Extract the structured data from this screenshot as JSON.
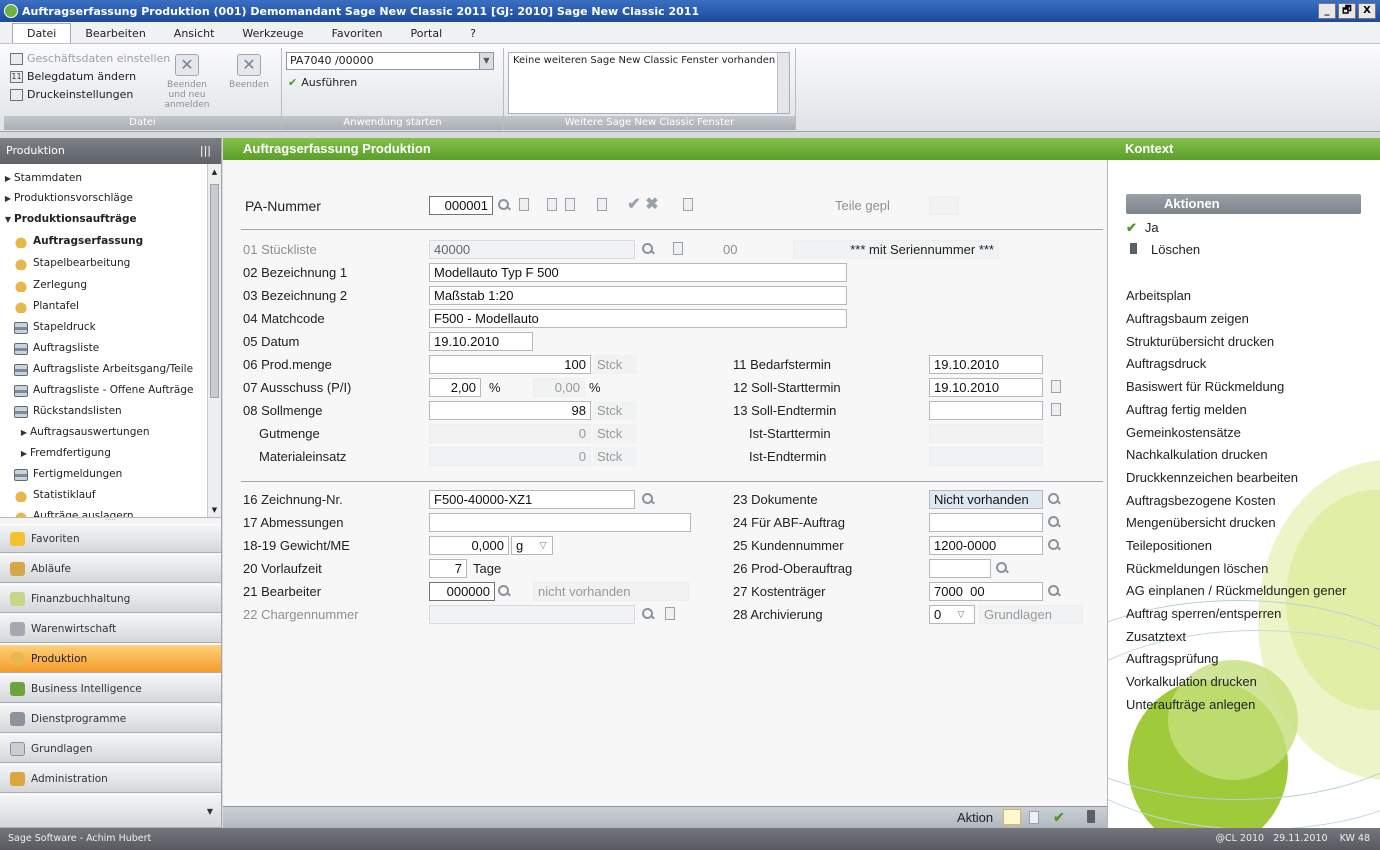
{
  "window": {
    "title": "Auftragserfassung Produktion (001) Demomandant Sage New Classic 2011 [GJ: 2010] Sage New Classic 2011",
    "buttons": [
      "_",
      "🗗",
      "X"
    ]
  },
  "menu": [
    "Datei",
    "Bearbeiten",
    "Ansicht",
    "Werkzeuge",
    "Favoriten",
    "Portal",
    "?"
  ],
  "ribbon": {
    "datei": {
      "caption": "Datei",
      "items": [
        "Geschäftsdaten einstellen",
        "Belegdatum ändern",
        "Druckeinstellungen"
      ],
      "btn1": "Beenden und neu anmelden",
      "btn2": "Beenden"
    },
    "anwendung": {
      "caption": "Anwendung starten",
      "combo": "PA7040 /00000",
      "run": "Ausführen"
    },
    "fenster": {
      "caption": "Weitere Sage New Classic Fenster",
      "text": "Keine weiteren Sage New Classic Fenster vorhanden"
    }
  },
  "nav": {
    "title": "Produktion",
    "tree": [
      {
        "label": "Stammdaten",
        "arrow": "▶"
      },
      {
        "label": "Produktionsvorschläge",
        "arrow": "▶"
      },
      {
        "label": "Produktionsaufträge",
        "arrow": "▼"
      },
      {
        "label": "Auftragserfassung"
      },
      {
        "label": "Stapelbearbeitung"
      },
      {
        "label": "Zerlegung"
      },
      {
        "label": "Plantafel"
      },
      {
        "label": "Stapeldruck"
      },
      {
        "label": "Auftragsliste"
      },
      {
        "label": "Auftragsliste Arbeitsgang/Teile"
      },
      {
        "label": "Auftragsliste - Offene Aufträge"
      },
      {
        "label": "Rückstandslisten"
      },
      {
        "label": "Auftragsauswertungen",
        "arrow": "▶"
      },
      {
        "label": "Fremdfertigung",
        "arrow": "▶"
      },
      {
        "label": "Fertigmeldungen"
      },
      {
        "label": "Statistiklauf"
      },
      {
        "label": "Aufträge auslagern"
      }
    ],
    "modules": [
      "Favoriten",
      "Abläufe",
      "Finanzbuchhaltung",
      "Warenwirtschaft",
      "Produktion",
      "Business Intelligence",
      "Dienstprogramme",
      "Grundlagen",
      "Administration"
    ],
    "gripper": "·····"
  },
  "main": {
    "title": "Auftragserfassung Produktion",
    "pa_label": "PA-Nummer",
    "pa_value": "000001",
    "teile": "Teile gepl",
    "f01": {
      "label": "01 Stückliste",
      "value": "40000",
      "num": "00",
      "note": "*** mit Seriennummer ***"
    },
    "f02": {
      "label": "02 Bezeichnung 1",
      "value": "Modellauto Typ F 500"
    },
    "f03": {
      "label": "03 Bezeichnung 2",
      "value": "Maßstab 1:20"
    },
    "f04": {
      "label": "04 Matchcode",
      "value": "F500 - Modellauto"
    },
    "f05": {
      "label": "05 Datum",
      "value": "19.10.2010"
    },
    "f06": {
      "label": "06 Prod.menge",
      "value": "100",
      "unit": "Stck"
    },
    "f07": {
      "label": "07 Ausschuss (P/I)",
      "value": "2,00",
      "pct": "%",
      "value2": "0,00",
      "pct2": "%"
    },
    "f08": {
      "label": "08 Sollmenge",
      "value": "98",
      "unit": "Stck"
    },
    "gut": {
      "label": "Gutmenge",
      "value": "0",
      "unit": "Stck"
    },
    "mat": {
      "label": "Materialeinsatz",
      "value": "0",
      "unit": "Stck"
    },
    "f11": {
      "label": "11 Bedarfstermin",
      "value": "19.10.2010"
    },
    "f12": {
      "label": "12 Soll-Starttermin",
      "value": "19.10.2010"
    },
    "f13": {
      "label": "13 Soll-Endtermin",
      "value": ""
    },
    "iststart": {
      "label": "Ist-Starttermin"
    },
    "istend": {
      "label": "Ist-Endtermin"
    },
    "f16": {
      "label": "16 Zeichnung-Nr.",
      "value": "F500-40000-XZ1"
    },
    "f17": {
      "label": "17 Abmessungen",
      "value": ""
    },
    "f1819": {
      "label": "18-19 Gewicht/ME",
      "value": "0,000",
      "unit": "g"
    },
    "f20": {
      "label": "20 Vorlaufzeit",
      "value": "7",
      "unit": "Tage"
    },
    "f21": {
      "label": "21 Bearbeiter",
      "value": "000000",
      "note": "nicht vorhanden"
    },
    "f22": {
      "label": "22 Chargennummer",
      "value": ""
    },
    "f23": {
      "label": "23 Dokumente",
      "value": "Nicht vorhanden"
    },
    "f24": {
      "label": "24 Für ABF-Auftrag",
      "value": ""
    },
    "f25": {
      "label": "25 Kundennummer",
      "value": "1200-0000"
    },
    "f26": {
      "label": "26 Prod-Oberauftrag",
      "value": ""
    },
    "f27": {
      "label": "27 Kostenträger",
      "value": "7000  00"
    },
    "f28": {
      "label": "28 Archivierung",
      "value": "0",
      "note": "Grundlagen"
    }
  },
  "actionbar": {
    "label": "Aktion"
  },
  "context": {
    "title": "Kontext",
    "aktionen": "Aktionen",
    "ja": "Ja",
    "loeschen": "Löschen",
    "items": [
      "Arbeitsplan",
      "Auftragsbaum zeigen",
      "Strukturübersicht drucken",
      "Auftragsdruck",
      "Basiswert für Rückmeldung",
      "Auftrag fertig melden",
      "Gemeinkostensätze",
      "Nachkalkulation drucken",
      "Druckkennzeichen bearbeiten",
      "Auftragsbezogene Kosten",
      "Mengenübersicht drucken",
      "Teilepositionen",
      "Rückmeldungen löschen",
      "AG einplanen / Rückmeldungen gener",
      "Auftrag sperren/entsperren",
      "Zusatztext",
      "Auftragsprüfung",
      "Vorkalkulation drucken",
      "Unteraufträge anlegen"
    ]
  },
  "status": {
    "left": "Sage Software - Achim Hubert",
    "right": "@CL 2010   29.11.2010    KW 48"
  }
}
